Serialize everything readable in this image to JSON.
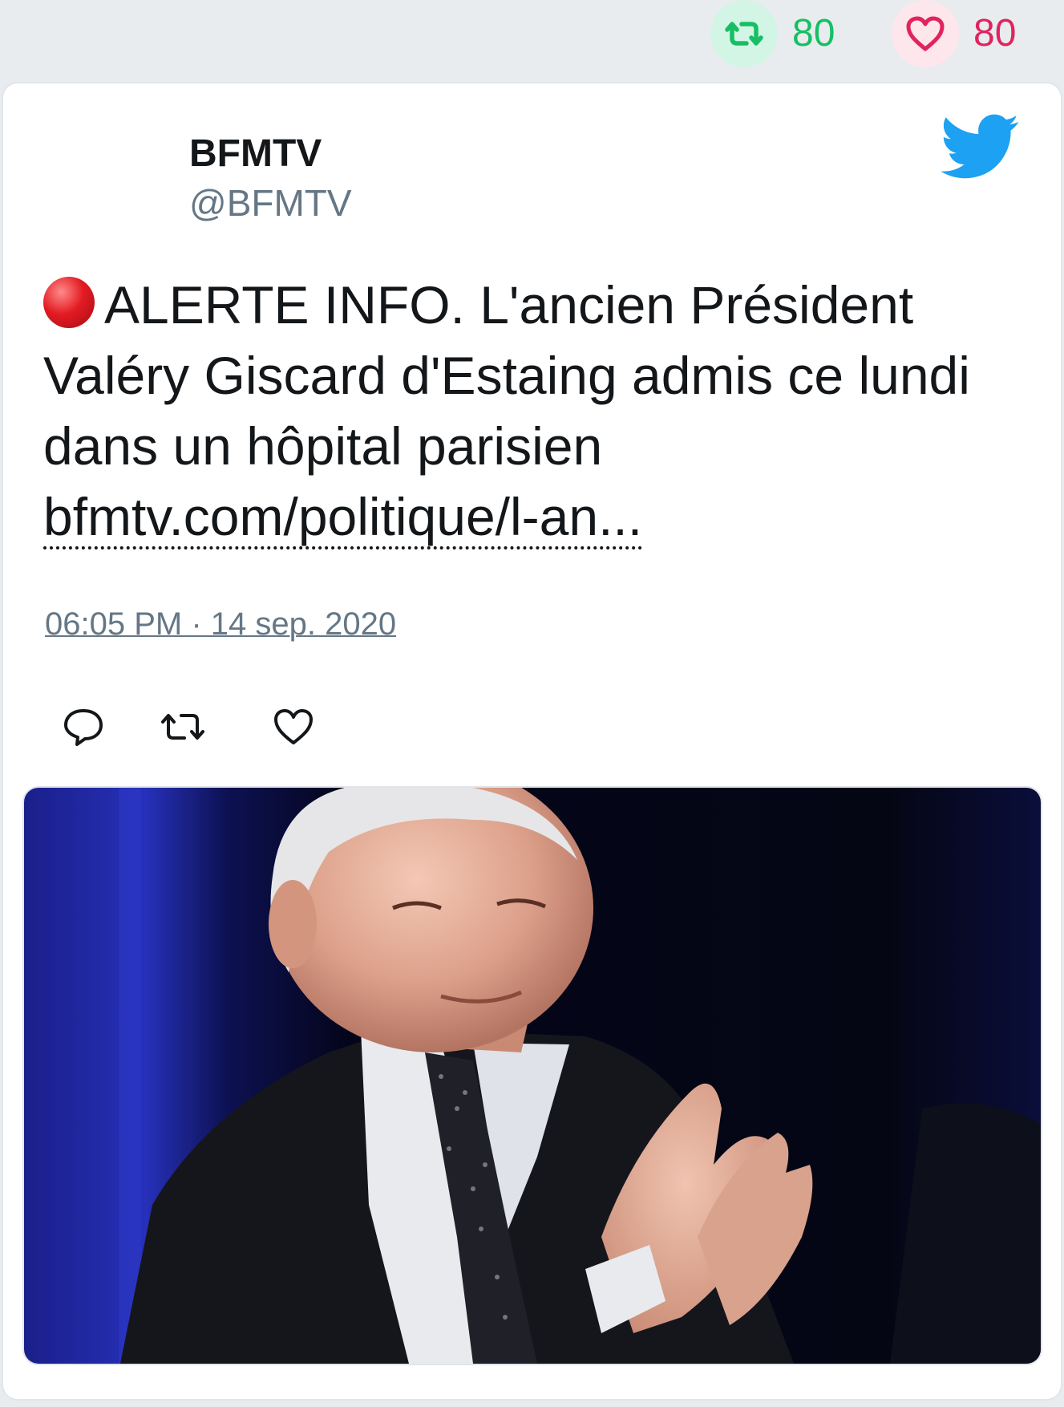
{
  "stats": {
    "retweet_count": "80",
    "like_count": "80",
    "retweet_color": "#17bf63",
    "like_color": "#e0245e",
    "retweet_icon": "retweet-icon",
    "like_icon": "heart-icon"
  },
  "tweet": {
    "author_name": "BFMTV",
    "author_handle": "@BFMTV",
    "platform_icon": "twitter-bird-icon",
    "alert_emoji": "red-circle-icon",
    "text": "ALERTE INFO. L'ancien Président Valéry Giscard d'Estaing admis ce lundi dans un hôpital parisien",
    "link_text": "bfmtv.com/politique/l-an...",
    "timestamp": "06:05 PM · 14 sep. 2020",
    "actions": [
      "reply-icon",
      "retweet-icon",
      "heart-icon"
    ],
    "media": "photo-elderly-man-applauding"
  }
}
